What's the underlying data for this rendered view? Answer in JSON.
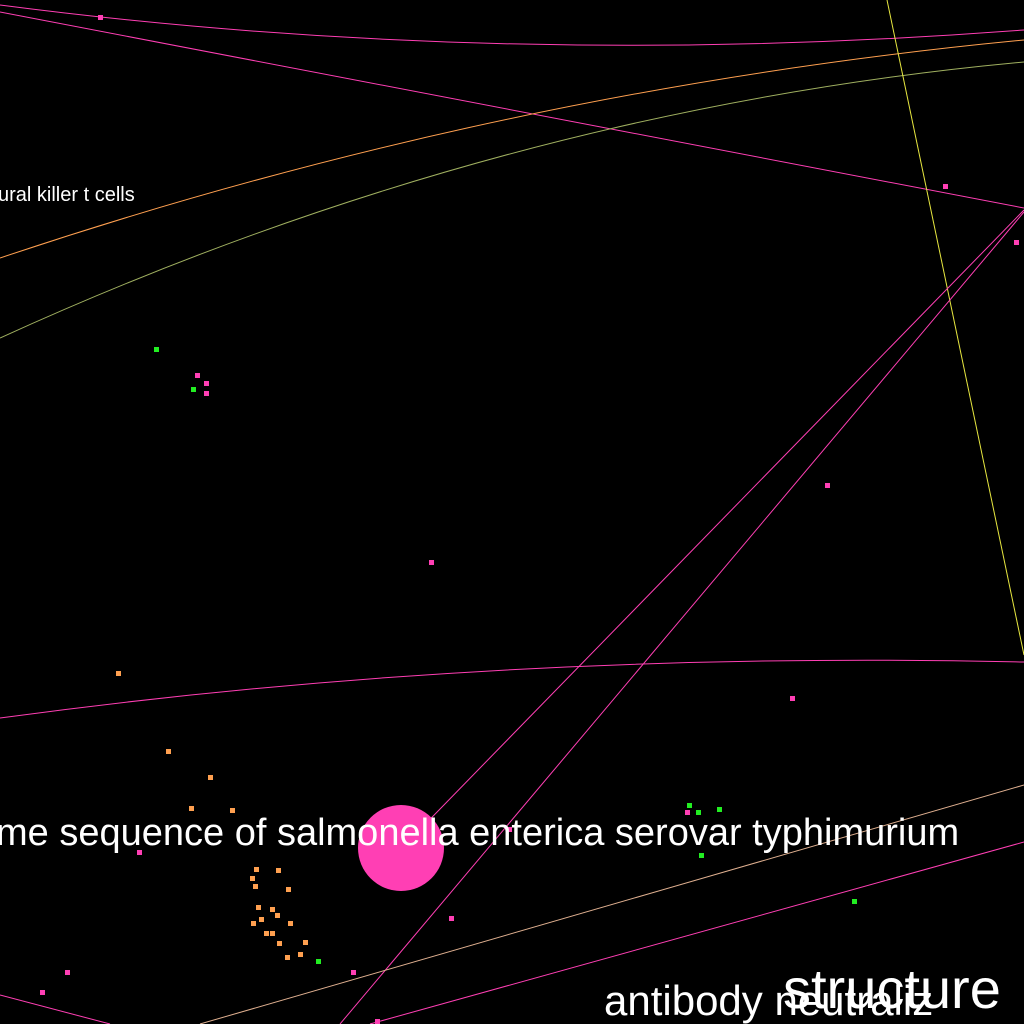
{
  "colors": {
    "background": "#000000",
    "label": "#ffffff",
    "pink": "#ff3fb4",
    "orange": "#ffa050",
    "green": "#22ee22",
    "yellow": "#e8e840",
    "tan": "#e0b090",
    "olive": "#a0b060"
  },
  "labels": {
    "nkt": "ural killer t cells",
    "genome": "me sequence of salmonella enterica serovar typhimurium",
    "antibody": "antibody neutraliz",
    "structure": "structure"
  }
}
